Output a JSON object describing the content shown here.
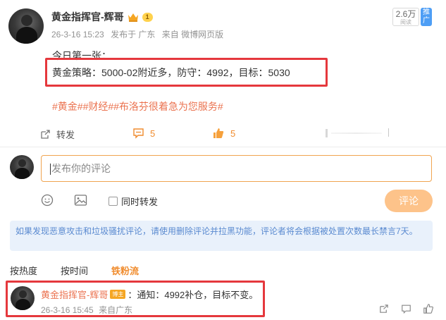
{
  "post": {
    "author": "黄金指挥官-辉哥",
    "level": "1",
    "time": "26-3-16 15:23",
    "published_in": "发布于 广东",
    "source": "来自 微博网页版",
    "read_count": "2.6万",
    "read_label": "阅读",
    "promote_label": "推广",
    "line1": "今日第一张：",
    "line2": "黄金策略：5000-02附近多，防守：4992，目标：5030",
    "tags": "#黄金##财经##布洛芬很着急为您服务#"
  },
  "actions": {
    "repost_label": "转发",
    "comments_count": "5",
    "likes_count": "5"
  },
  "comment_box": {
    "placeholder": "发布你的评论",
    "repost_label": "同时转发",
    "submit_label": "评论"
  },
  "notice": "如果发现恶意攻击和垃圾骚扰评论，请使用删除评论并拉黑功能，评论者将会根据被处置次数最长禁言7天。",
  "sort": {
    "hot": "按热度",
    "time": "按时间",
    "fans": "铁粉流"
  },
  "comment": {
    "author": "黄金指挥官-辉哥",
    "host_tag": "博主",
    "text": "：通知：4992补仓，目标不变。",
    "time": "26-3-16 15:45",
    "source": "来自广东"
  },
  "colors": {
    "accent": "#f08c2e",
    "highlight_box": "#e5383d",
    "notice_bg": "#e9f1fb",
    "tag": "#eb7350"
  }
}
